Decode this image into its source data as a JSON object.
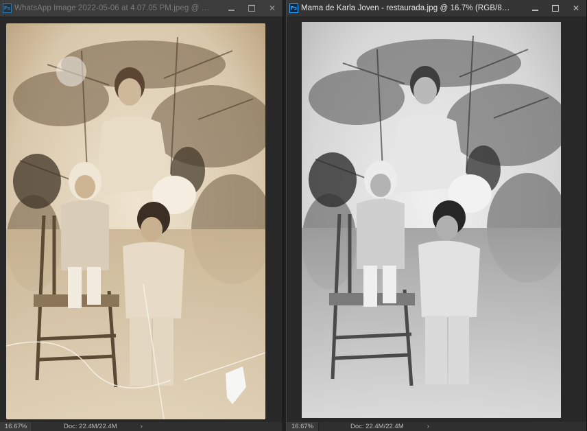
{
  "windows": [
    {
      "title": "WhatsApp Image 2022-05-06 at 4.07.05 PM.jpeg @ …",
      "app_icon": "Ps",
      "zoom": "16.67%",
      "doc_info": "Doc: 22.4M/22.4M",
      "photo_tone": "sepia"
    },
    {
      "title": "Mama de Karla Joven - restaurada.jpg @ 16.7% (RGB/8…",
      "app_icon": "Ps",
      "zoom": "16.67%",
      "doc_info": "Doc: 22.4M/22.4M",
      "photo_tone": "grayscale"
    }
  ],
  "controls": {
    "minimize": "minimize-icon",
    "maximize": "maximize-icon",
    "close": "close-icon",
    "status_arrow": "chevron-right-icon"
  },
  "colors": {
    "ps_blue": "#31a8ff",
    "chrome": "#2b2b2b",
    "sepia_light": "#e3d6bf",
    "sepia_dark": "#5b4a36",
    "gray_light": "#e6e6e6",
    "gray_dark": "#3a3a3a"
  }
}
